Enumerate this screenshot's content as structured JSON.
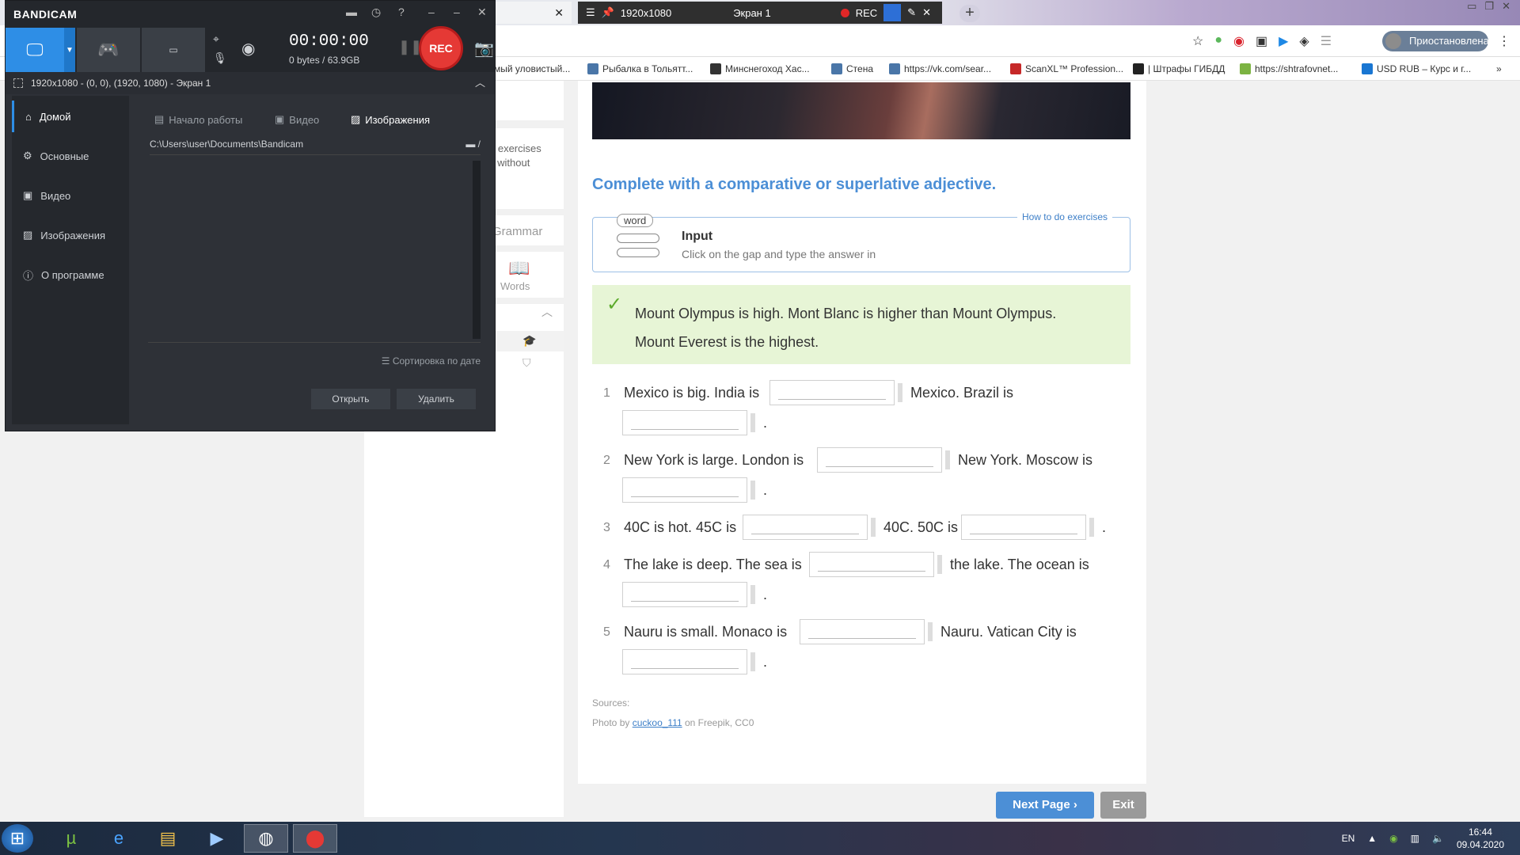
{
  "browser": {
    "tabs": [
      {
        "title": "1920x1080"
      },
      {
        "title": "Экран 1"
      },
      {
        "title": "REC"
      }
    ],
    "profile_label": "Приостановлена",
    "bookmarks": [
      "мый уловистый...",
      "Рыбалка в Тольятт...",
      "Минснегоход Хас...",
      "Стена",
      "https://vk.com/sear...",
      "ScanXL™ Profession...",
      "| Штрафы ГИБДД",
      "https://shtrafovnet...",
      "USD RUB – Курс и г..."
    ]
  },
  "sidebar_frag": {
    "text1": "o exercises",
    "text2": "y without",
    "grammar": "Grammar",
    "words": "Words"
  },
  "exercise": {
    "title": "Complete with a comparative or superlative adjective.",
    "howto": "How to do exercises",
    "word_badge": "word",
    "input_title": "Input",
    "input_sub": "Click on the gap and type the answer in",
    "example_line1": "Mount Olympus is high. Mont Blanc is higher than Mount Olympus.",
    "example_line2": "Mount Everest is the highest.",
    "items": [
      {
        "num": "1",
        "a": "Mexico is big. India is",
        "b": "Mexico. Brazil is",
        "end": "."
      },
      {
        "num": "2",
        "a": "New York is large. London is",
        "b": "New York. Moscow is",
        "end": "."
      },
      {
        "num": "3",
        "a": "40C is hot. 45C is",
        "b": "40C. 50C is",
        "end": "."
      },
      {
        "num": "4",
        "a": "The lake is deep. The sea is",
        "b": "the lake. The ocean is",
        "end": "."
      },
      {
        "num": "5",
        "a": "Nauru is small. Monaco is",
        "b": "Nauru. Vatican City is",
        "end": "."
      }
    ],
    "sources_label": "Sources:",
    "photo_prefix": "Photo by",
    "photo_author": "cuckoo_111",
    "photo_suffix": "on Freepik, CC0",
    "next_label": "Next Page",
    "exit_label": "Exit"
  },
  "bandicam": {
    "logo_a": "BANDI",
    "logo_b": "CAM",
    "timer": "00:00:00",
    "size": "0 bytes / 63.9GB",
    "rec_label": "REC",
    "area": "1920x1080 - (0, 0), (1920, 1080) - Экран 1",
    "nav": [
      "Домой",
      "Основные",
      "Видео",
      "Изображения",
      "О программе"
    ],
    "tabs": [
      "Начало работы",
      "Видео",
      "Изображения"
    ],
    "path": "C:\\Users\\user\\Documents\\Bandicam",
    "sort": "Сортировка по дате",
    "open": "Открыть",
    "delete": "Удалить"
  },
  "taskbar": {
    "lang": "EN",
    "time": "16:44",
    "date": "09.04.2020"
  }
}
